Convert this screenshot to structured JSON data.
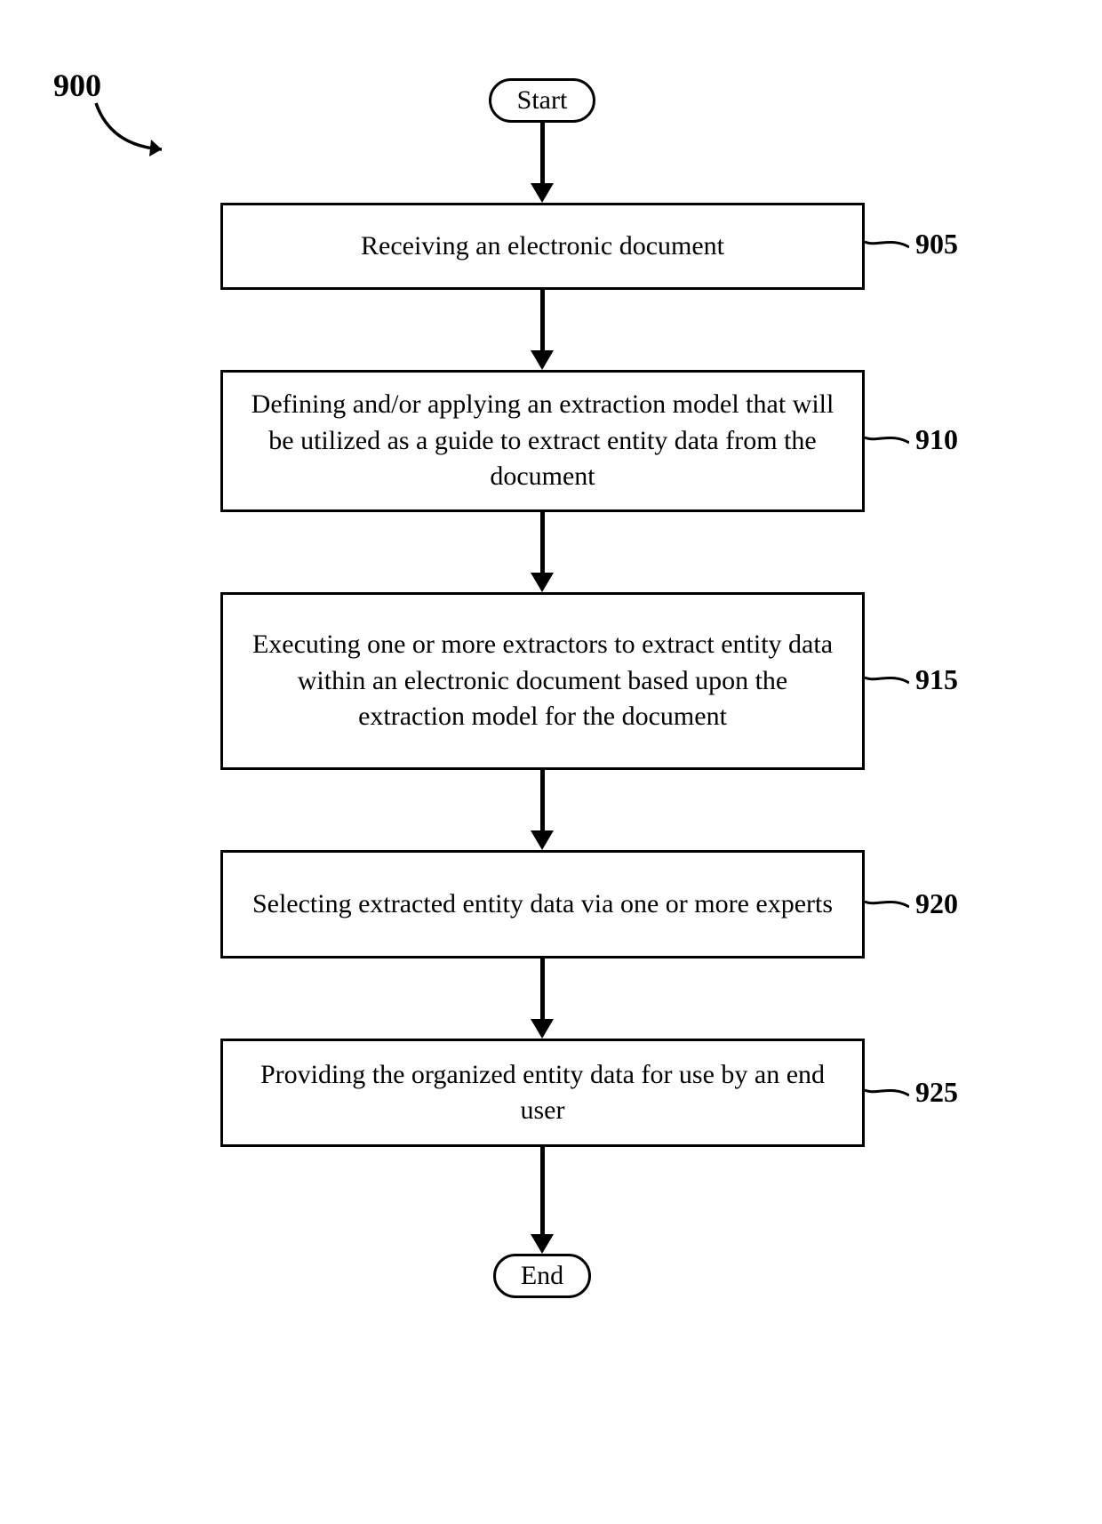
{
  "figure_number": "900",
  "start_label": "Start",
  "end_label": "End",
  "steps": [
    {
      "ref": "905",
      "text": "Receiving an electronic document"
    },
    {
      "ref": "910",
      "text": "Defining and/or applying an extraction model that will be utilized as a guide to extract entity data from the document"
    },
    {
      "ref": "915",
      "text": "Executing one or more extractors to extract entity data within an electronic document based upon the extraction model for the document"
    },
    {
      "ref": "920",
      "text": "Selecting extracted entity data via one or more experts"
    },
    {
      "ref": "925",
      "text": "Providing the organized entity data for use by an end user"
    }
  ],
  "chart_data": {
    "type": "flowchart",
    "title": "",
    "nodes": [
      {
        "id": "start",
        "shape": "terminator",
        "label": "Start"
      },
      {
        "id": "905",
        "shape": "process",
        "label": "Receiving an electronic document"
      },
      {
        "id": "910",
        "shape": "process",
        "label": "Defining and/or applying an extraction model that will be utilized as a guide to extract entity data from the document"
      },
      {
        "id": "915",
        "shape": "process",
        "label": "Executing one or more extractors to extract entity data within an electronic document based upon the extraction model for the document"
      },
      {
        "id": "920",
        "shape": "process",
        "label": "Selecting extracted entity data via one or more experts"
      },
      {
        "id": "925",
        "shape": "process",
        "label": "Providing the organized entity data for use by an end user"
      },
      {
        "id": "end",
        "shape": "terminator",
        "label": "End"
      }
    ],
    "edges": [
      {
        "from": "start",
        "to": "905"
      },
      {
        "from": "905",
        "to": "910"
      },
      {
        "from": "910",
        "to": "915"
      },
      {
        "from": "915",
        "to": "920"
      },
      {
        "from": "920",
        "to": "925"
      },
      {
        "from": "925",
        "to": "end"
      }
    ]
  }
}
